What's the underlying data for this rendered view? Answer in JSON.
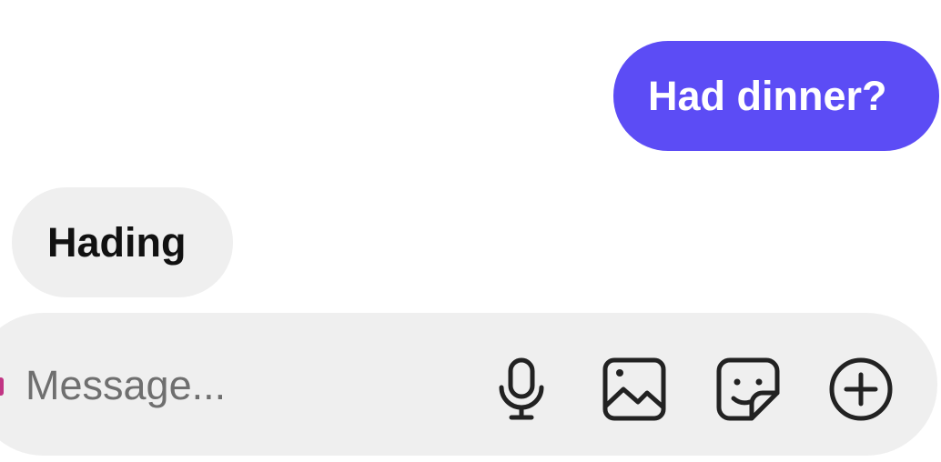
{
  "messages": [
    {
      "direction": "outgoing",
      "text": "Had dinner?"
    },
    {
      "direction": "incoming",
      "text": "Hading"
    }
  ],
  "composer": {
    "placeholder": "Message...",
    "icons": [
      "microphone-icon",
      "gallery-icon",
      "sticker-icon",
      "plus-circle-icon"
    ]
  },
  "colors": {
    "outgoing_bubble": "#5c4cf5",
    "incoming_bubble": "#efefef",
    "composer_bg": "#efefef"
  }
}
